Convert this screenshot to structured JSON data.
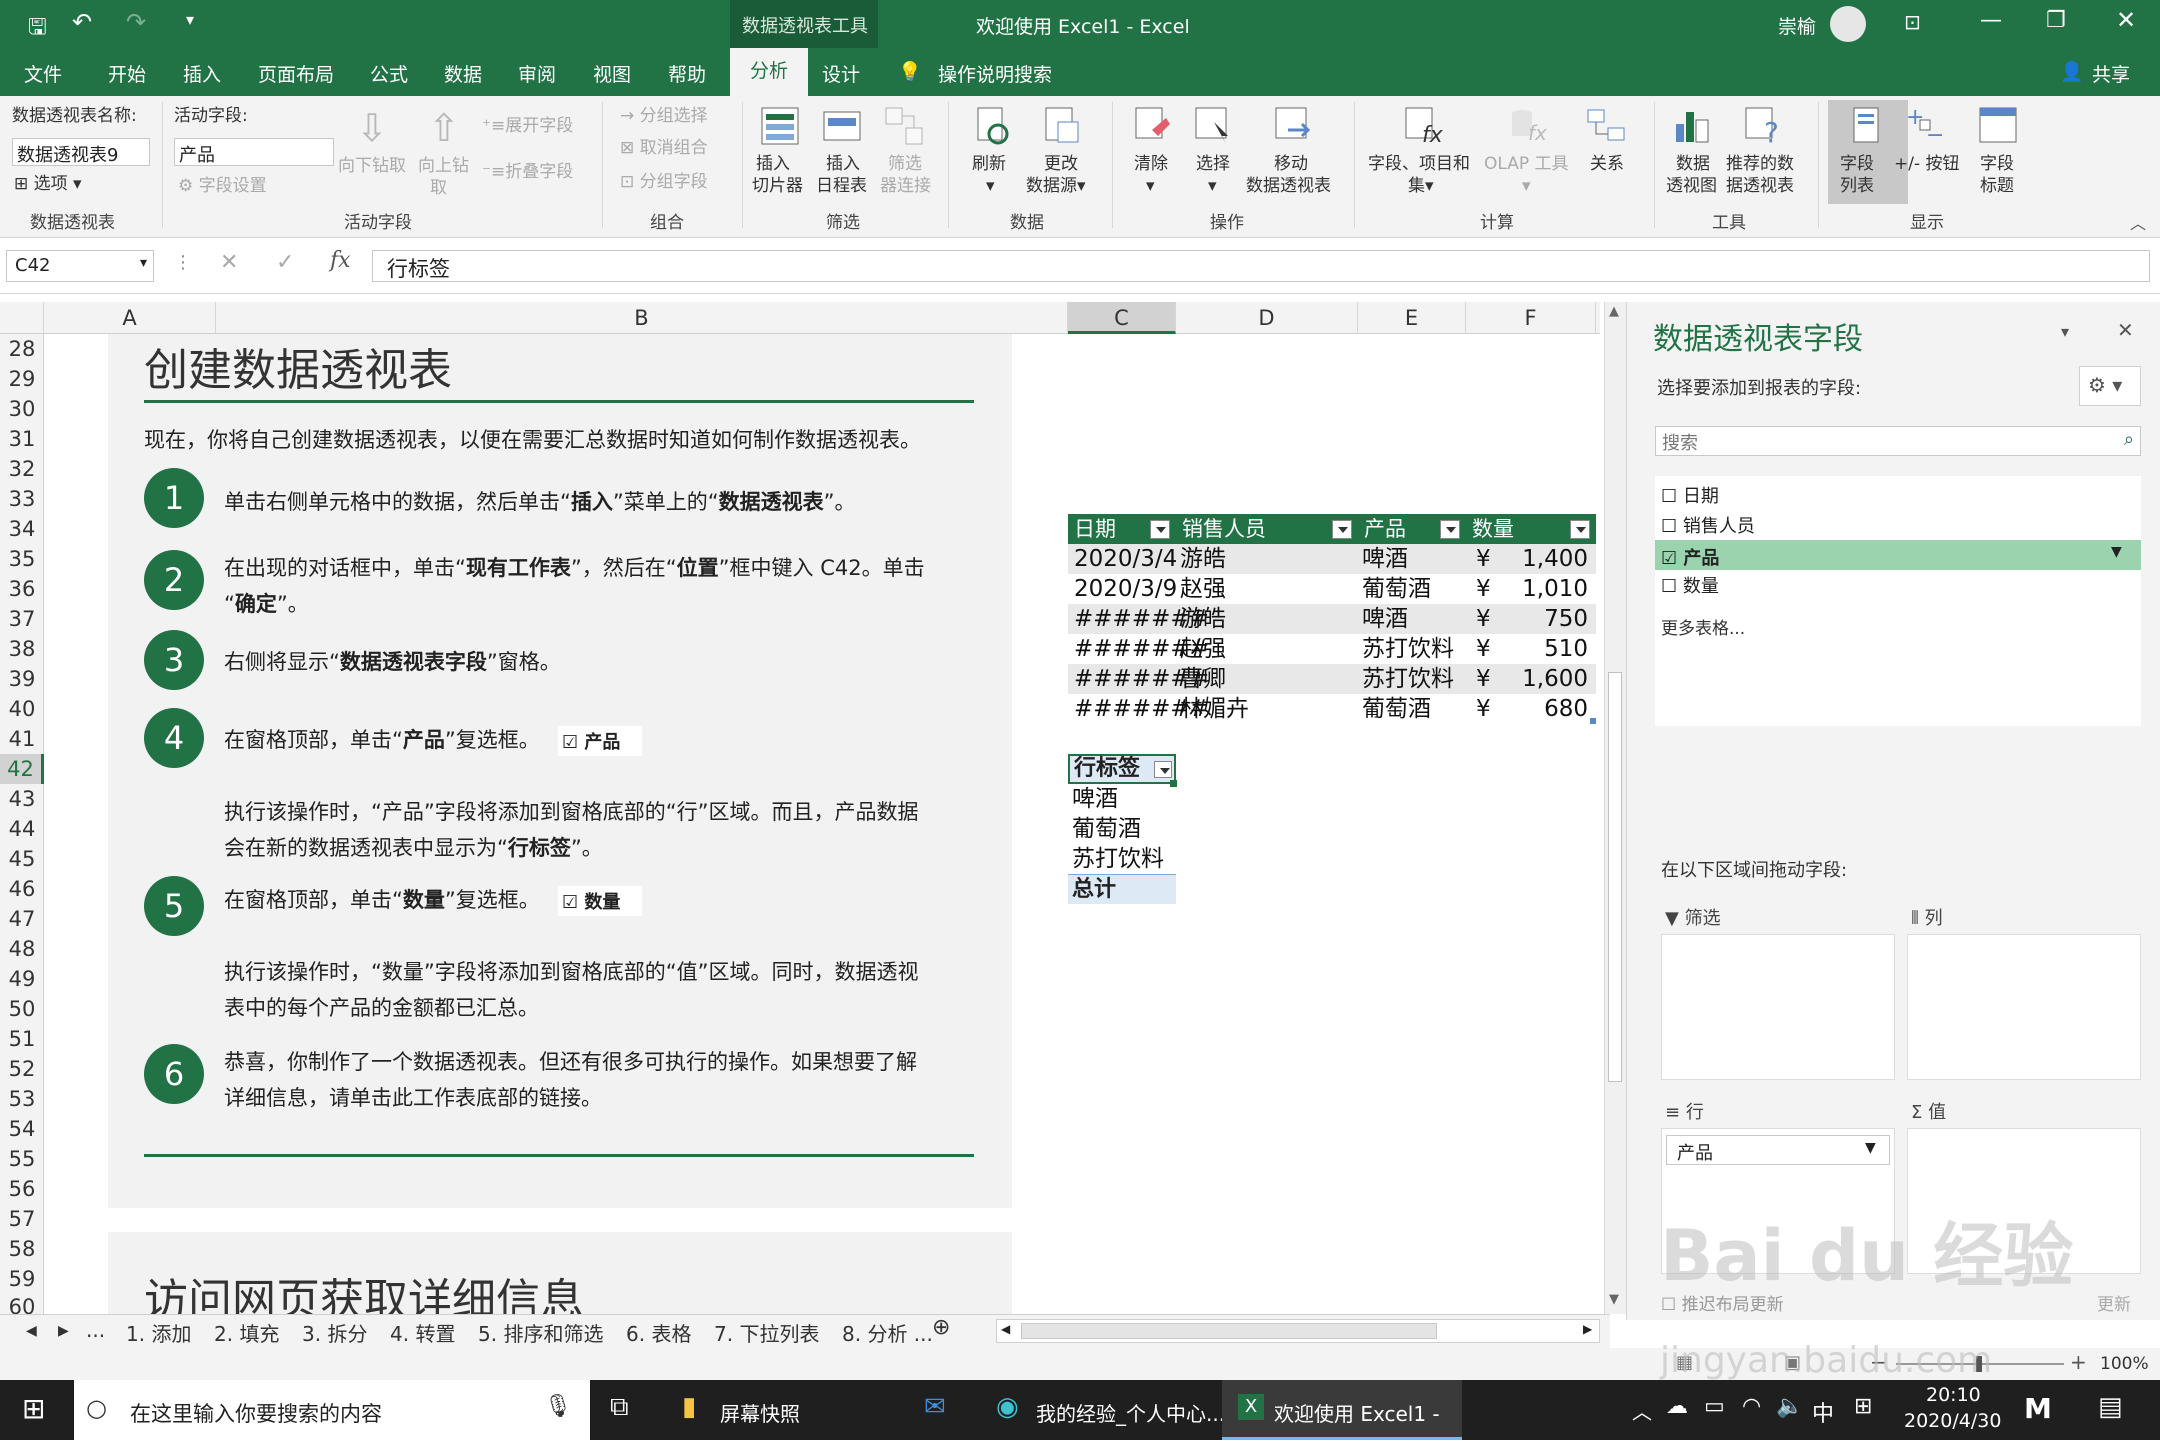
{
  "window": {
    "title": "欢迎使用 Excel1  -  Excel",
    "context": "数据透视表工具",
    "user": "崇榆"
  },
  "menu": {
    "items": [
      "文件",
      "开始",
      "插入",
      "页面布局",
      "公式",
      "数据",
      "审阅",
      "视图",
      "帮助",
      "分析",
      "设计"
    ],
    "tell_me": "操作说明搜索",
    "share": "共享"
  },
  "ribbon": {
    "pivot_name_label": "数据透视表名称:",
    "pivot_name_value": "数据透视表9",
    "options": "选项",
    "active_field_label": "活动字段:",
    "active_field_value": "产品",
    "field_settings": "字段设置",
    "drill_down": "向下钻取",
    "drill_up_1": "向上钻",
    "drill_up_2": "取",
    "expand": "展开字段",
    "collapse": "折叠字段",
    "group_selection": "分组选择",
    "ungroup": "取消组合",
    "group_field": "分组字段",
    "insert_slicer_1": "插入",
    "insert_slicer_2": "切片器",
    "insert_timeline_1": "插入",
    "insert_timeline_2": "日程表",
    "filter_conn_1": "筛选",
    "filter_conn_2": "器连接",
    "refresh": "刷新",
    "change_source_1": "更改",
    "change_source_2": "数据源",
    "clear": "清除",
    "select": "选择",
    "move_1": "移动",
    "move_2": "数据透视表",
    "fields_items_1": "字段、项目和",
    "fields_items_2": "集",
    "olap": "OLAP 工具",
    "relations": "关系",
    "pivot_chart_1": "数据",
    "pivot_chart_2": "透视图",
    "recommended_1": "推荐的数",
    "recommended_2": "据透视表",
    "field_list_1": "字段",
    "field_list_2": "列表",
    "buttons": "+/- 按钮",
    "headers_1": "字段",
    "headers_2": "标题",
    "groups": [
      "数据透视表",
      "活动字段",
      "组合",
      "筛选",
      "数据",
      "操作",
      "计算",
      "工具",
      "显示"
    ]
  },
  "formula": {
    "namebox": "C42",
    "content": "行标签"
  },
  "columns": [
    "A",
    "B",
    "C",
    "D",
    "E",
    "F"
  ],
  "rows": [
    "28",
    "29",
    "30",
    "31",
    "32",
    "33",
    "34",
    "35",
    "36",
    "37",
    "38",
    "39",
    "40",
    "41",
    "42",
    "43",
    "44",
    "45",
    "46",
    "47",
    "48",
    "49",
    "50",
    "51",
    "52",
    "53",
    "54",
    "55",
    "56",
    "57",
    "58",
    "59",
    "60"
  ],
  "tutorial": {
    "title": "创建数据透视表",
    "intro": "现在，你将自己创建数据透视表，以便在需要汇总数据时知道如何制作数据透视表。",
    "steps": [
      {
        "n": "1",
        "a": "单击右侧单元格中的数据，然后单击“",
        "b": "插入",
        "c": "”菜单上的“",
        "d": "数据透视表",
        "e": "”。"
      },
      {
        "n": "2",
        "a": "在出现的对话框中，单击“",
        "b": "现有工作表",
        "c": "”，然后在“",
        "d": "位置",
        "e": "”框中键入 C42。单击",
        "f": "“",
        "g": "确定",
        "h": "”。"
      },
      {
        "n": "3",
        "a": "右侧将显示“",
        "b": "数据透视表字段",
        "c": "”窗格。"
      },
      {
        "n": "4",
        "a": "在窗格顶部，单击“",
        "b": "产品",
        "c": "”复选框。",
        "chk": "产品"
      },
      {
        "n": "5",
        "a": "在窗格顶部，单击“",
        "b": "数量",
        "c": "”复选框。",
        "chk": "数量"
      },
      {
        "n": "6",
        "a": "恭喜，你制作了一个数据透视表。但还有很多可执行的操作。如果想要了解",
        "b": "详细信息，请单击此工作表底部的链接。"
      }
    ],
    "note4_1": "执行该操作时，“产品”字段将添加到窗格底部的“行”区域。而且，产品数据",
    "note4_2a": "会在新的数据透视表中显示为“",
    "note4_2b": "行标签",
    "note4_2c": "”。",
    "note5_1": "执行该操作时，“数量”字段将添加到窗格底部的“值”区域。同时，数据透视",
    "note5_2": "表中的每个产品的金额都已汇总。",
    "title2": "访问网页获取详细信息"
  },
  "table": {
    "headers": [
      "日期",
      "销售人员",
      "产品",
      "数量"
    ],
    "currency": "¥",
    "rows": [
      {
        "date": "2020/3/4",
        "person": "游皓",
        "product": "啤酒",
        "qty": "1,400"
      },
      {
        "date": "2020/3/9",
        "person": "赵强",
        "product": "葡萄酒",
        "qty": "1,010"
      },
      {
        "date": "#######",
        "person": "游皓",
        "product": "啤酒",
        "qty": "750"
      },
      {
        "date": "#######",
        "person": "赵强",
        "product": "苏打饮料",
        "qty": "510"
      },
      {
        "date": "#######",
        "person": "曹卿",
        "product": "苏打饮料",
        "qty": "1,600"
      },
      {
        "date": "#######",
        "person": "林媚卉",
        "product": "葡萄酒",
        "qty": "680"
      }
    ]
  },
  "pivot": {
    "header": "行标签",
    "items": [
      "啤酒",
      "葡萄酒",
      "苏打饮料"
    ],
    "total": "总计"
  },
  "pane": {
    "title": "数据透视表字段",
    "choose": "选择要添加到报表的字段:",
    "search_placeholder": "搜索",
    "fields": [
      "日期",
      "销售人员",
      "产品",
      "数量"
    ],
    "more": "更多表格...",
    "drag": "在以下区域间拖动字段:",
    "filters": "筛选",
    "columns": "列",
    "rows": "行",
    "values": "值",
    "row_field": "产品",
    "defer": "推迟布局更新",
    "update": "更新"
  },
  "sheets": [
    "1. 添加",
    "2. 填充",
    "3. 拆分",
    "4. 转置",
    "5. 排序和筛选",
    "6. 表格",
    "7. 下拉列表",
    "8. 分析 ..."
  ],
  "status": {
    "zoom": "100%"
  },
  "taskbar": {
    "search": "在这里输入你要搜索的内容",
    "app1": "屏幕快照",
    "app2": "我的经验_个人中心...",
    "app3": "欢迎使用 Excel1 - ...",
    "ime": "中",
    "time": "20:10",
    "date": "2020/4/30"
  },
  "watermark": {
    "text": "Bai du 经验",
    "url": "jingyan.baidu.com"
  }
}
